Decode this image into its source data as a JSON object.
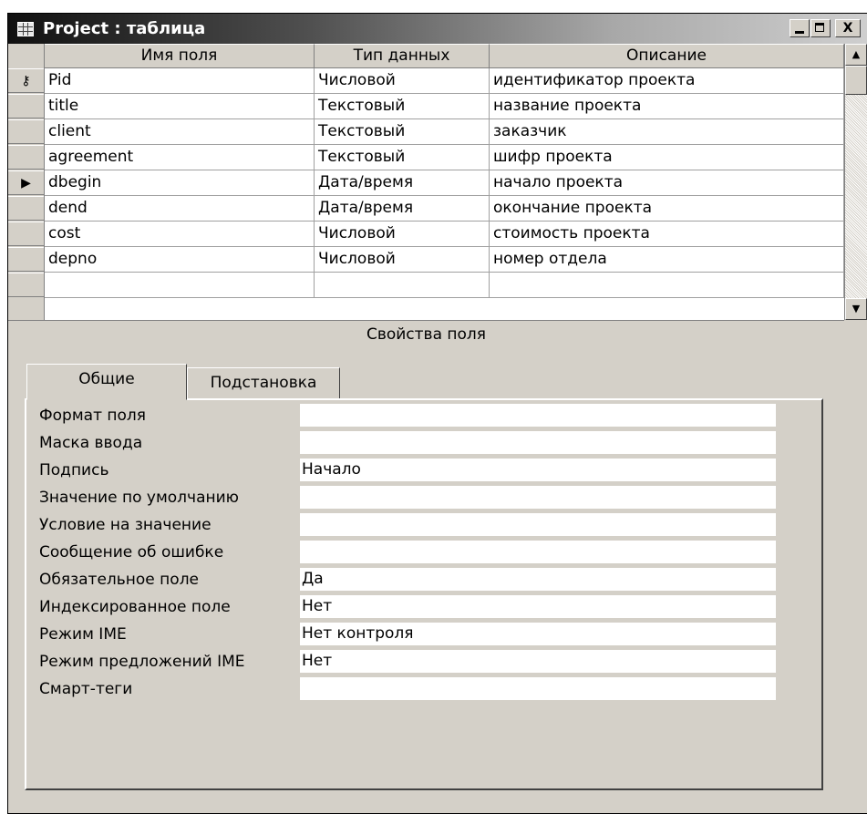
{
  "window": {
    "title": "Project : таблица",
    "min_label": "_",
    "close_label": "X"
  },
  "grid": {
    "headers": [
      "Имя поля",
      "Тип данных",
      "Описание"
    ],
    "rows": [
      {
        "selector": "key",
        "name": "Pid",
        "type": "Числовой",
        "description": "идентификатор проекта"
      },
      {
        "selector": "",
        "name": "title",
        "type": "Текстовый",
        "description": "название проекта"
      },
      {
        "selector": "",
        "name": "client",
        "type": "Текстовый",
        "description": "заказчик"
      },
      {
        "selector": "",
        "name": "agreement",
        "type": "Текстовый",
        "description": "шифр проекта"
      },
      {
        "selector": "current",
        "name": "dbegin",
        "type": "Дата/время",
        "description": "начало проекта"
      },
      {
        "selector": "",
        "name": "dend",
        "type": "Дата/время",
        "description": "окончание проекта"
      },
      {
        "selector": "",
        "name": "cost",
        "type": "Числовой",
        "description": "стоимость проекта"
      },
      {
        "selector": "",
        "name": "depno",
        "type": "Числовой",
        "description": "номер отдела"
      },
      {
        "selector": "",
        "name": "",
        "type": "",
        "description": ""
      }
    ],
    "selector_glyphs": {
      "key": "⚷",
      "current": "▶"
    },
    "scroll_up": "▲",
    "scroll_down": "▼"
  },
  "properties": {
    "section_label": "Свойства поля",
    "tabs": [
      "Общие",
      "Подстановка"
    ],
    "active_tab": "Общие",
    "items": [
      {
        "label": "Формат поля",
        "value": ""
      },
      {
        "label": "Маска ввода",
        "value": ""
      },
      {
        "label": "Подпись",
        "value": "Начало"
      },
      {
        "label": "Значение по умолчанию",
        "value": ""
      },
      {
        "label": "Условие на значение",
        "value": ""
      },
      {
        "label": "Сообщение об ошибке",
        "value": ""
      },
      {
        "label": "Обязательное поле",
        "value": "Да"
      },
      {
        "label": "Индексированное поле",
        "value": "Нет"
      },
      {
        "label": "Режим IME",
        "value": "Нет контроля"
      },
      {
        "label": "Режим предложений IME",
        "value": "Нет"
      },
      {
        "label": "Смарт-теги",
        "value": ""
      }
    ]
  }
}
